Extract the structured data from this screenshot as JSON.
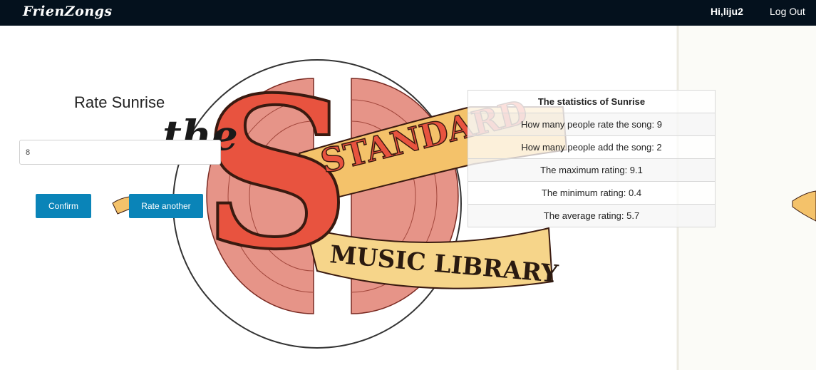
{
  "navbar": {
    "brand": "FrienZongs",
    "greeting": "Hi,liju2",
    "logout": "Log Out"
  },
  "background": {
    "logo_text_the": "the",
    "logo_text_standard": "STANDARD",
    "logo_text_library": "MUSIC LIBRARY"
  },
  "rating": {
    "title": "Rate Sunrise",
    "input_value": "8",
    "confirm_label": "Confirm",
    "rate_another_label": "Rate another"
  },
  "stats": {
    "header": "The statistics of Sunrise",
    "rows": [
      "How many people rate the song: 9",
      "How many people add the song: 2",
      "The maximum rating: 9.1",
      "The minimum rating: 0.4",
      "The average rating: 5.7"
    ]
  },
  "colors": {
    "navbar_bg": "#04111d",
    "button_bg": "#0a84b8",
    "logo_red": "#e8533f",
    "logo_ribbon": "#f4c26a"
  }
}
